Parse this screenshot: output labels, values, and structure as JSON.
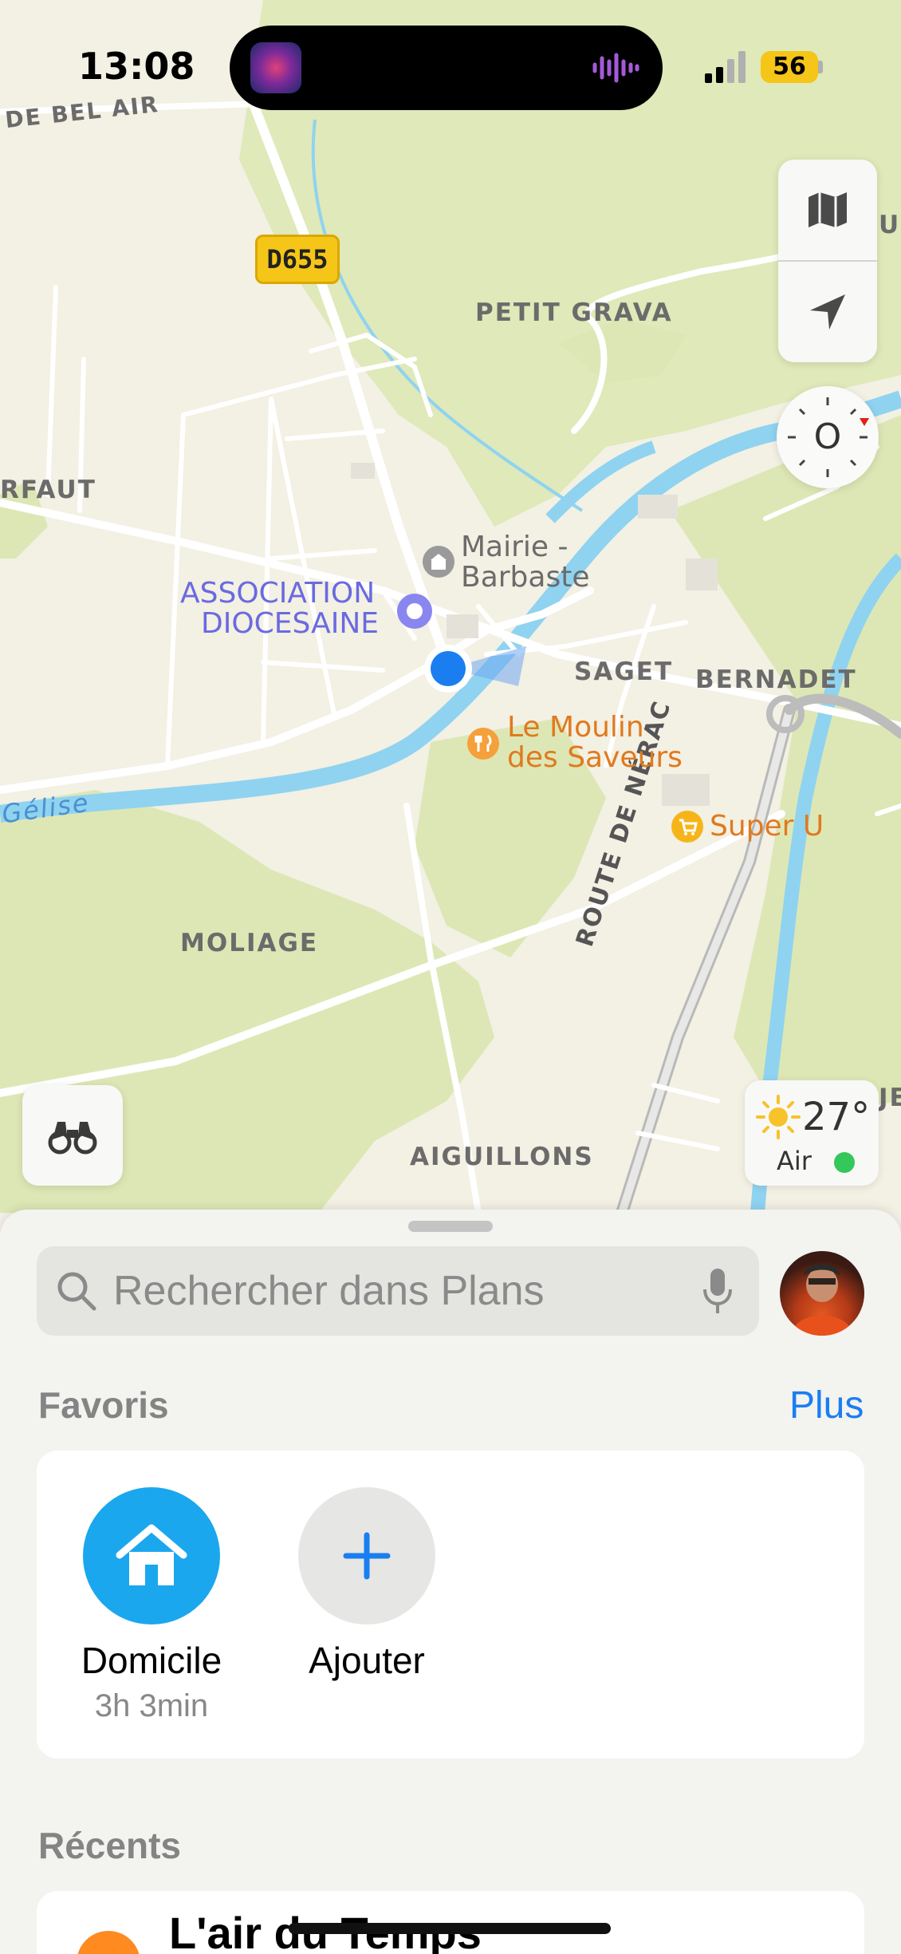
{
  "status_bar": {
    "time": "13:08",
    "battery": "56",
    "island_app_icon": "music-app-icon",
    "island_activity_icon": "waveform-icon"
  },
  "map": {
    "labels": {
      "de_bel_air": "DE BEL AIR",
      "petit_grava": "PETIT GRAVA",
      "rfaut": "RFAUT",
      "saget": "SAGET",
      "bernadet": "BERNADET",
      "moliage": "MOLIAGE",
      "aiguillons": "AIGUILLONS",
      "route_de_nerac": "ROUTE DE NÉRAC",
      "gelise": "Gélise",
      "edge_us": "US",
      "edge_je": "JE"
    },
    "road_shield": "D655",
    "pois": {
      "mairie_line1": "Mairie -",
      "mairie_line2": "Barbaste",
      "assoc_line1": "ASSOCIATION",
      "assoc_line2": "DIOCESAINE",
      "moulin_line1": "Le Moulin",
      "moulin_line2": "des Saveurs",
      "superu": "Super U"
    },
    "controls": {
      "map_mode_icon": "map-icon",
      "locate_icon": "location-arrow-icon",
      "compass_letter": "O",
      "binoculars_icon": "binoculars-icon"
    },
    "weather": {
      "temperature": "27°",
      "air_label": "Air",
      "air_quality_color": "#34c759",
      "icon": "sun-icon"
    }
  },
  "sheet": {
    "search": {
      "placeholder": "Rechercher dans Plans",
      "icon": "search-icon",
      "mic_icon": "microphone-icon"
    },
    "favorites": {
      "title": "Favoris",
      "more_label": "Plus",
      "items": [
        {
          "label": "Domicile",
          "sublabel": "3h 3min",
          "icon": "house-icon"
        },
        {
          "label": "Ajouter",
          "icon": "plus-icon"
        }
      ]
    },
    "recents": {
      "title": "Récents",
      "first_item": "L'air du Temps"
    }
  },
  "colors": {
    "accent": "#1a7ef0",
    "home_blue": "#1aa7ee",
    "water": "#8fd3f0",
    "park": "#dde7b8"
  }
}
